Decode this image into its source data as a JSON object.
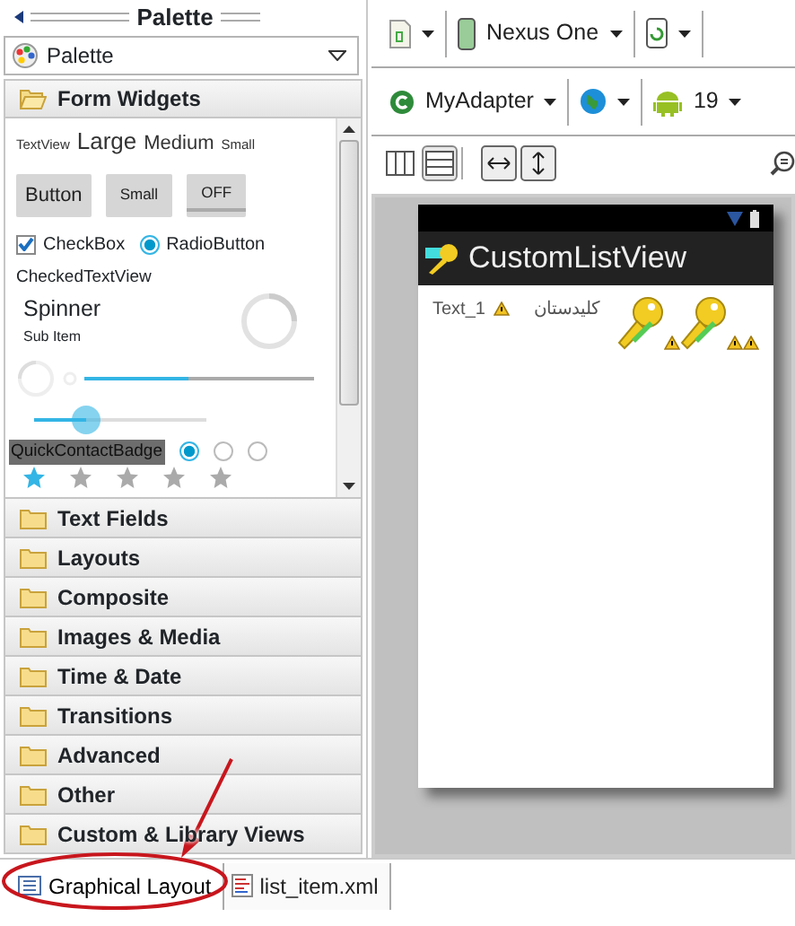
{
  "palette_view": {
    "title": "Palette"
  },
  "palette_selector": {
    "label": "Palette"
  },
  "categories": [
    {
      "label": "Form Widgets",
      "expanded": true
    },
    {
      "label": "Text Fields",
      "expanded": false
    },
    {
      "label": "Layouts",
      "expanded": false
    },
    {
      "label": "Composite",
      "expanded": false
    },
    {
      "label": "Images & Media",
      "expanded": false
    },
    {
      "label": "Time & Date",
      "expanded": false
    },
    {
      "label": "Transitions",
      "expanded": false
    },
    {
      "label": "Advanced",
      "expanded": false
    },
    {
      "label": "Other",
      "expanded": false
    },
    {
      "label": "Custom & Library Views",
      "expanded": false
    }
  ],
  "form_widgets": {
    "text_sizes": [
      "TextView",
      "Large",
      "Medium",
      "Small"
    ],
    "buttons": [
      "Button",
      "Small",
      "OFF"
    ],
    "checkbox": {
      "label": "CheckBox",
      "checked": true
    },
    "radio": {
      "label": "RadioButton",
      "selected": true
    },
    "checked_text_view": "CheckedTextView",
    "spinner": {
      "title": "Spinner",
      "subtitle": "Sub Item"
    },
    "progress": {
      "level": 0.45
    },
    "seekbar": {
      "level": 0.3
    },
    "quick_contact_badge": "QuickContactBadge",
    "radio_group": [
      {
        "selected": true
      },
      {
        "selected": false
      },
      {
        "selected": false
      }
    ],
    "rating": {
      "stars": 1
    }
  },
  "toolbar": {
    "device": "Nexus One",
    "activity": "MyAdapter",
    "api_level": "19",
    "view_modes": [
      {
        "selected": false
      },
      {
        "selected": true
      }
    ]
  },
  "preview": {
    "app_title": "CustomListView",
    "list_item": {
      "text": "Text_1",
      "label": "کلیدستان"
    }
  },
  "editor_tabs": [
    {
      "label": "Graphical Layout",
      "selected": true
    },
    {
      "label": "list_item.xml",
      "selected": false
    }
  ]
}
